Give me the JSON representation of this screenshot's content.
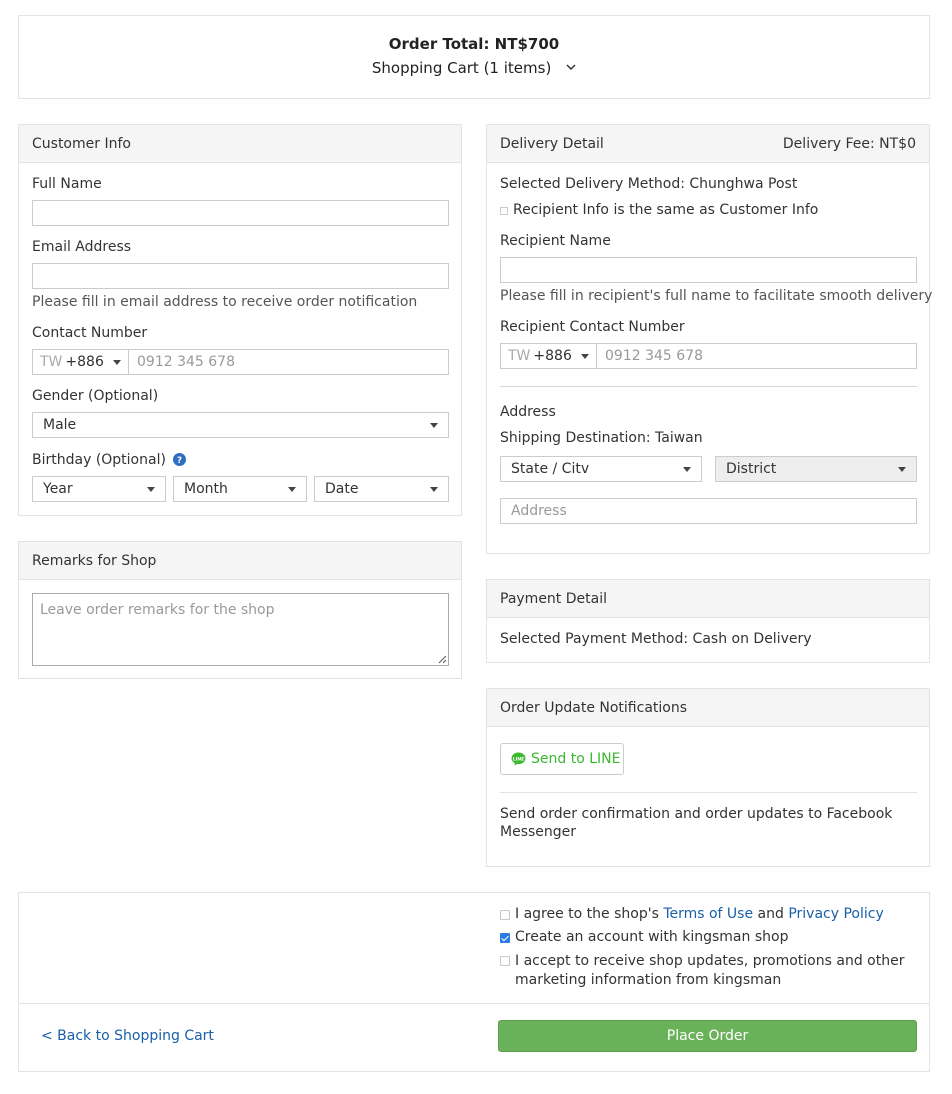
{
  "order_summary": {
    "total": "Order Total: NT$700",
    "cart": "Shopping Cart (1 items)"
  },
  "customer_info": {
    "title": "Customer Info",
    "full_name_label": "Full Name",
    "email_label": "Email Address",
    "email_help": "Please fill in email address to receive order notification",
    "contact_label": "Contact Number",
    "phone_country": "TW",
    "phone_code": "+886",
    "phone_placeholder": "0912 345 678",
    "gender_label": "Gender (Optional)",
    "gender_value": "Male",
    "birthday_label": "Birthday (Optional)",
    "year": "Year",
    "month": "Month",
    "date": "Date"
  },
  "remarks": {
    "title": "Remarks for Shop",
    "placeholder": "Leave order remarks for the shop"
  },
  "delivery": {
    "title": "Delivery Detail",
    "fee": "Delivery Fee: NT$0",
    "method": "Selected Delivery Method: Chunghwa Post",
    "same_as_customer": "Recipient Info is the same as Customer Info",
    "same_as_customer_checked": false,
    "recipient_name_label": "Recipient Name",
    "recipient_help": "Please fill in recipient's full name to facilitate smooth delivery",
    "recipient_contact_label": "Recipient Contact Number",
    "phone_country": "TW",
    "phone_code": "+886",
    "phone_placeholder": "0912 345 678",
    "address_label": "Address",
    "destination": "Shipping Destination: Taiwan",
    "state_city": "State / Citv",
    "district": "District",
    "address_placeholder": "Address"
  },
  "payment": {
    "title": "Payment Detail",
    "method": "Selected Payment Method: Cash on Delivery"
  },
  "notifications": {
    "title": "Order Update Notifications",
    "line_button": "Send to LINE",
    "messenger_text": "Send order confirmation and order updates to Facebook Messenger"
  },
  "agreements": {
    "terms_prefix": "I agree to the shop's ",
    "terms_link": "Terms of Use",
    "terms_and": " and ",
    "privacy_link": "Privacy Policy",
    "terms_checked": false,
    "create_account": "Create an account with kingsman shop",
    "create_account_checked": true,
    "marketing": "I accept to receive shop updates, promotions and other marketing information from kingsman",
    "marketing_checked": false
  },
  "footer": {
    "back_link": "< Back to Shopping Cart",
    "place_order": "Place Order"
  },
  "colors": {
    "accent_green": "#6ab25a",
    "line_green": "#3bb92f",
    "link_blue": "#1a5fa8",
    "checkbox_blue": "#2c7be5"
  }
}
